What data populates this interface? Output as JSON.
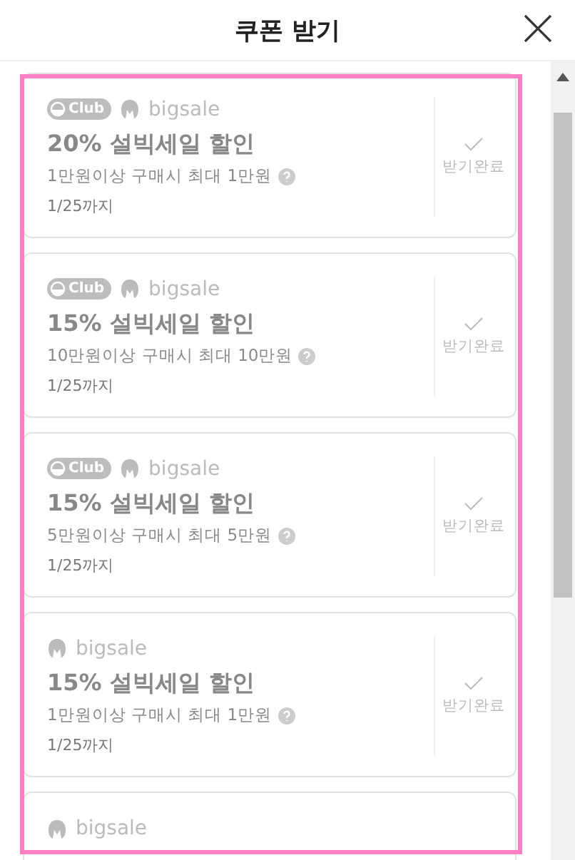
{
  "header": {
    "title": "쿠폰 받기"
  },
  "coupons": [
    {
      "club": "Club",
      "brand": "bigsale",
      "title": "20% 설빅세일 할인",
      "condition": "1만원이상 구매시 최대 1만원",
      "until": "1/25까지",
      "status": "받기완료",
      "received": true
    },
    {
      "club": "Club",
      "brand": "bigsale",
      "title": "15% 설빅세일 할인",
      "condition": "10만원이상 구매시 최대 10만원",
      "until": "1/25까지",
      "status": "받기완료",
      "received": true
    },
    {
      "club": "Club",
      "brand": "bigsale",
      "title": "15% 설빅세일 할인",
      "condition": "5만원이상 구매시 최대 5만원",
      "until": "1/25까지",
      "status": "받기완료",
      "received": true
    },
    {
      "brand": "bigsale",
      "title": "15% 설빅세일 할인",
      "condition": "1만원이상 구매시 최대 1만원",
      "until": "1/25까지",
      "status": "받기완료",
      "received": true
    },
    {
      "brand": "bigsale"
    }
  ]
}
